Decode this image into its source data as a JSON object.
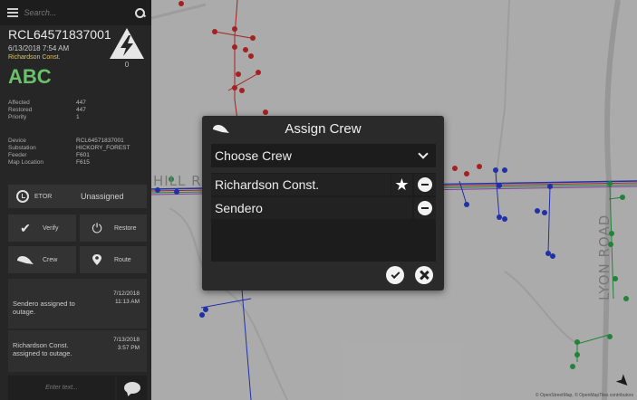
{
  "search": {
    "placeholder": "Search..."
  },
  "outage": {
    "id": "RCL64571837001",
    "timestamp": "6/13/2018 7:54 AM",
    "crew": "Richardson Const.",
    "code": "ABC",
    "count": "0"
  },
  "stats": [
    {
      "label": "Affected",
      "value": "447"
    },
    {
      "label": "Restored",
      "value": "447"
    },
    {
      "label": "Priority",
      "value": "1"
    }
  ],
  "details": [
    {
      "label": "Device",
      "value": "RCL64571837001"
    },
    {
      "label": "Substation",
      "value": "HICKORY_FOREST"
    },
    {
      "label": "Feeder",
      "value": "F601"
    },
    {
      "label": "Map Location",
      "value": "F615"
    }
  ],
  "actions": {
    "etor_label": "ETOR",
    "etor_value": "Unassigned",
    "verify": "Verify",
    "restore": "Restore",
    "crew": "Crew",
    "route": "Route"
  },
  "log": [
    {
      "message": "Sendero assigned to outage.",
      "date": "7/12/2018",
      "time": "11:13 AM"
    },
    {
      "message": "Richardson Const. assigned to outage.",
      "date": "7/13/2018",
      "time": "3:57 PM"
    }
  ],
  "composer": {
    "placeholder": "Enter text..."
  },
  "dialog": {
    "title": "Assign Crew",
    "select_value": "Choose Crew",
    "crews": [
      {
        "name": "Richardson Const.",
        "starred": true
      },
      {
        "name": "Sendero",
        "starred": false
      }
    ]
  },
  "map": {
    "road_lyon": "LYON ROAD",
    "road_hill": "HILL R",
    "attribution": "© OpenStreetMap, © OpenMapTiles contributors"
  },
  "colors": {
    "accent_green": "#6cc06c",
    "crew_yellow": "#d8c56b",
    "line_blue": "#2a3fd8",
    "line_red": "#d42a2a",
    "line_green": "#2aa84a",
    "line_purple": "#a64fd0"
  }
}
